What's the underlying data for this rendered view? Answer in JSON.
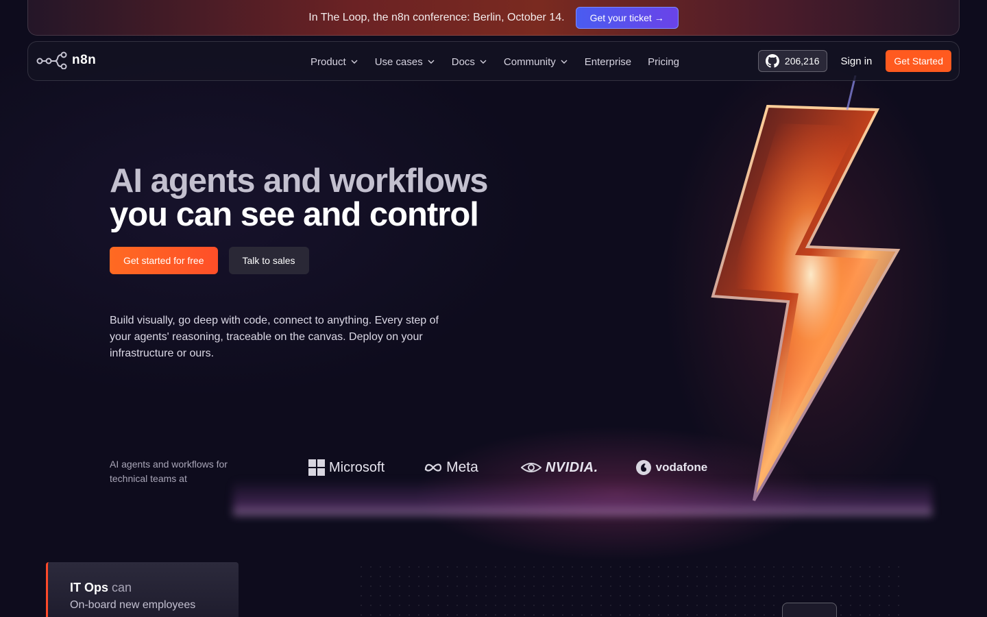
{
  "banner": {
    "text": "In The Loop, the n8n conference: Berlin, October 14.",
    "ticket_label": "Get your ticket →"
  },
  "nav": {
    "logo_text": "n8n",
    "links": [
      {
        "label": "Product",
        "dropdown": true
      },
      {
        "label": "Use cases",
        "dropdown": true
      },
      {
        "label": "Docs",
        "dropdown": true
      },
      {
        "label": "Community",
        "dropdown": true
      },
      {
        "label": "Enterprise",
        "dropdown": false
      },
      {
        "label": "Pricing",
        "dropdown": false
      }
    ],
    "github_stars": "206,216",
    "signin_label": "Sign in",
    "get_started_label": "Get Started"
  },
  "hero": {
    "title_line1": "AI agents and workflows",
    "title_line2": "you can see and control",
    "primary_cta": "Get started for free",
    "secondary_cta": "Talk to sales",
    "description": "Build visually, go deep with code, connect to anything. Every step of your agents' reasoning, traceable on the canvas. Deploy on your infrastructure or ours."
  },
  "trust": {
    "text": "AI agents and workflows for technical teams at",
    "brands": [
      "Microsoft",
      "Meta",
      "NVIDIA.",
      "vodafone"
    ]
  },
  "card": {
    "role": "IT Ops",
    "verb": "can",
    "action": "On-board new employees"
  },
  "colors": {
    "background": "#0e0c1d",
    "accent": "#ff5a1f",
    "ticket": "#5a50ec"
  }
}
